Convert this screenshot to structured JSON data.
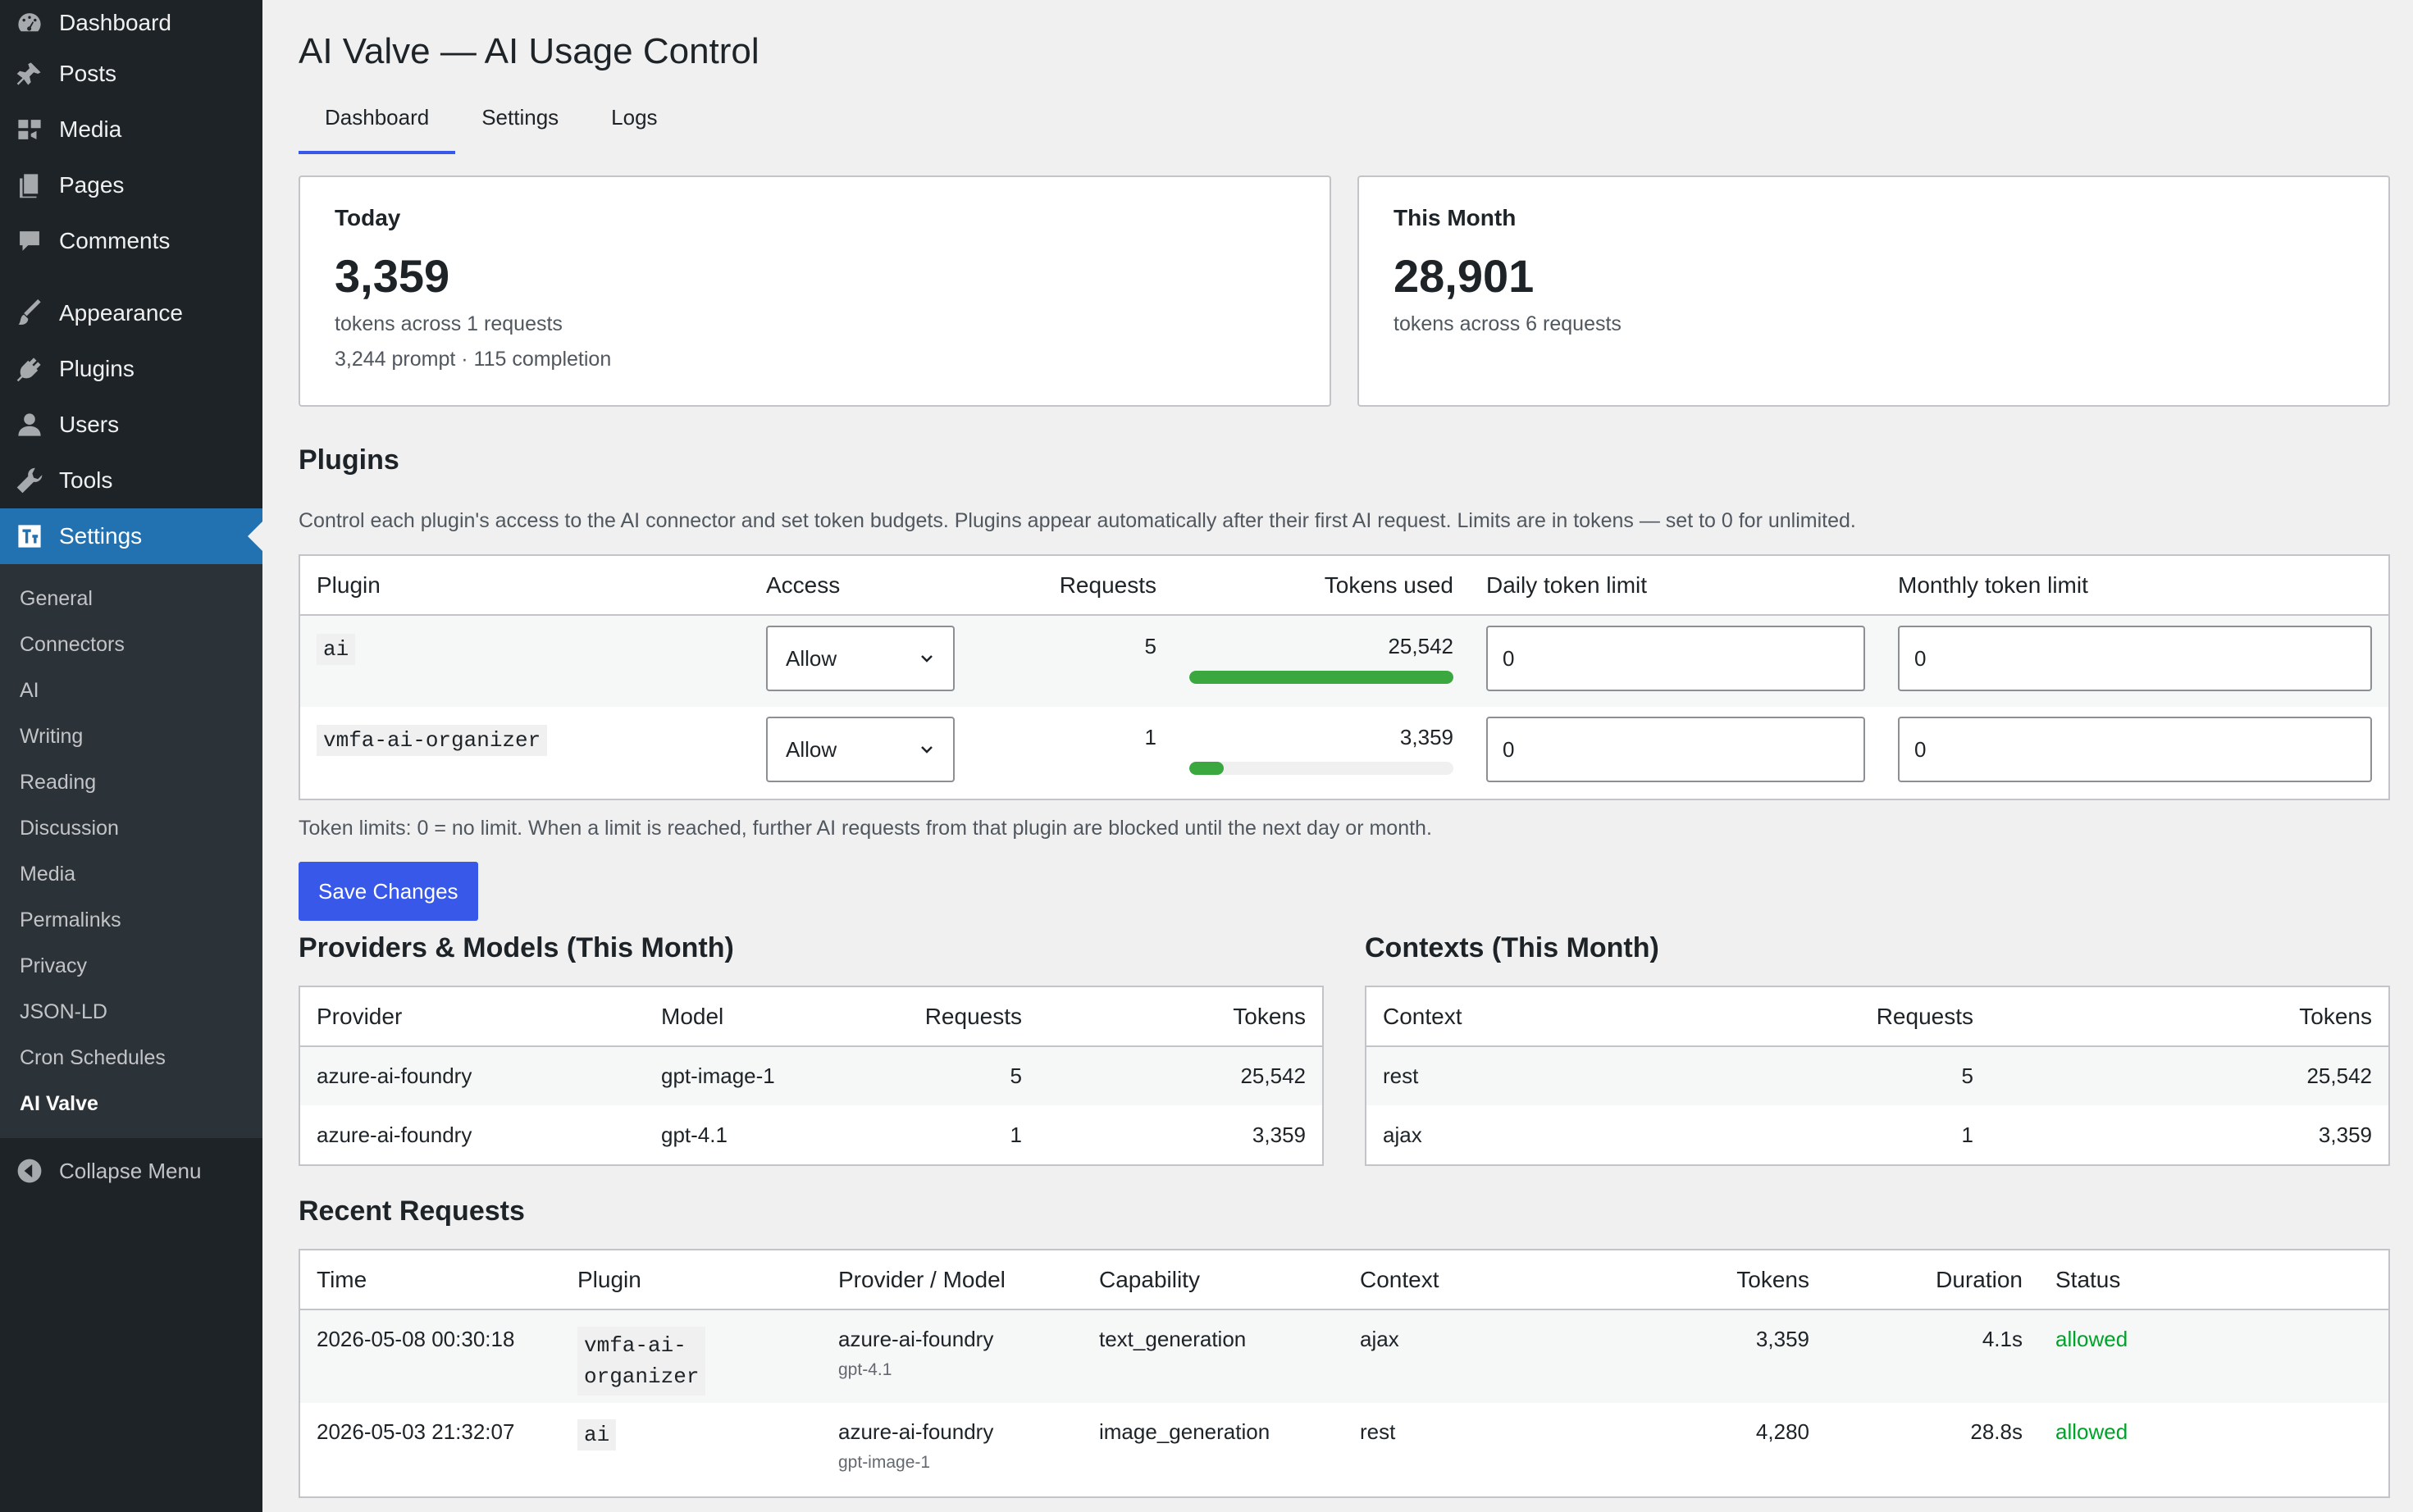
{
  "sidebar": {
    "top_items": [
      {
        "label": "Dashboard",
        "icon": "dashboard-icon"
      },
      {
        "label": "Posts",
        "icon": "pin-icon"
      },
      {
        "label": "Media",
        "icon": "media-icon"
      },
      {
        "label": "Pages",
        "icon": "pages-icon"
      },
      {
        "label": "Comments",
        "icon": "comments-icon"
      },
      {
        "label": "Appearance",
        "icon": "brush-icon"
      },
      {
        "label": "Plugins",
        "icon": "plugin-icon"
      },
      {
        "label": "Users",
        "icon": "user-icon"
      },
      {
        "label": "Tools",
        "icon": "wrench-icon"
      },
      {
        "label": "Settings",
        "icon": "settings-icon"
      }
    ],
    "submenu": [
      "General",
      "Connectors",
      "AI",
      "Writing",
      "Reading",
      "Discussion",
      "Media",
      "Permalinks",
      "Privacy",
      "JSON-LD",
      "Cron Schedules",
      "AI Valve"
    ],
    "collapse_label": "Collapse Menu"
  },
  "page": {
    "title": "AI Valve — AI Usage Control",
    "tabs": [
      "Dashboard",
      "Settings",
      "Logs"
    ]
  },
  "cards": {
    "today": {
      "title": "Today",
      "value": "3,359",
      "sub": "tokens across 1 requests",
      "sub2": "3,244 prompt · 115 completion"
    },
    "month": {
      "title": "This Month",
      "value": "28,901",
      "sub": "tokens across 6 requests"
    }
  },
  "plugins": {
    "heading": "Plugins",
    "description": "Control each plugin's access to the AI connector and set token budgets. Plugins appear automatically after their first AI request. Limits are in tokens — set to 0 for unlimited.",
    "columns": [
      "Plugin",
      "Access",
      "Requests",
      "Tokens used",
      "Daily token limit",
      "Monthly token limit"
    ],
    "rows": [
      {
        "plugin": "ai",
        "access": "Allow",
        "requests": "5",
        "tokens": "25,542",
        "share": 1.0,
        "daily": "0",
        "monthly": "0"
      },
      {
        "plugin": "vmfa-ai-organizer",
        "access": "Allow",
        "requests": "1",
        "tokens": "3,359",
        "share": 0.13,
        "daily": "0",
        "monthly": "0"
      }
    ],
    "note": "Token limits: 0 = no limit. When a limit is reached, further AI requests from that plugin are blocked until the next day or month.",
    "save_label": "Save Changes"
  },
  "providers": {
    "heading": "Providers & Models (This Month)",
    "columns": [
      "Provider",
      "Model",
      "Requests",
      "Tokens"
    ],
    "rows": [
      {
        "provider": "azure-ai-foundry",
        "model": "gpt-image-1",
        "requests": "5",
        "tokens": "25,542"
      },
      {
        "provider": "azure-ai-foundry",
        "model": "gpt-4.1",
        "requests": "1",
        "tokens": "3,359"
      }
    ]
  },
  "contexts": {
    "heading": "Contexts (This Month)",
    "columns": [
      "Context",
      "Requests",
      "Tokens"
    ],
    "rows": [
      {
        "context": "rest",
        "requests": "5",
        "tokens": "25,542"
      },
      {
        "context": "ajax",
        "requests": "1",
        "tokens": "3,359"
      }
    ]
  },
  "recent": {
    "heading": "Recent Requests",
    "columns": [
      "Time",
      "Plugin",
      "Provider / Model",
      "Capability",
      "Context",
      "Tokens",
      "Duration",
      "Status"
    ],
    "rows": [
      {
        "time": "2026-05-08 00:30:18",
        "plugin_line1": "vmfa-ai-",
        "plugin_line2": "organizer",
        "provider": "azure-ai-foundry",
        "model": "gpt-4.1",
        "capability": "text_generation",
        "context": "ajax",
        "tokens": "3,359",
        "duration": "4.1s",
        "status": "allowed"
      },
      {
        "time": "2026-05-03 21:32:07",
        "plugin_line1": "ai",
        "plugin_line2": "",
        "provider": "azure-ai-foundry",
        "model": "gpt-image-1",
        "capability": "image_generation",
        "context": "rest",
        "tokens": "4,280",
        "duration": "28.8s",
        "status": "allowed"
      }
    ]
  },
  "colors": {
    "accent": "#3858e9",
    "sidebar": "#1d2327",
    "current_menu": "#2271b1",
    "bar_fill": "#3aa83f",
    "status_allowed": "#00a32a"
  }
}
